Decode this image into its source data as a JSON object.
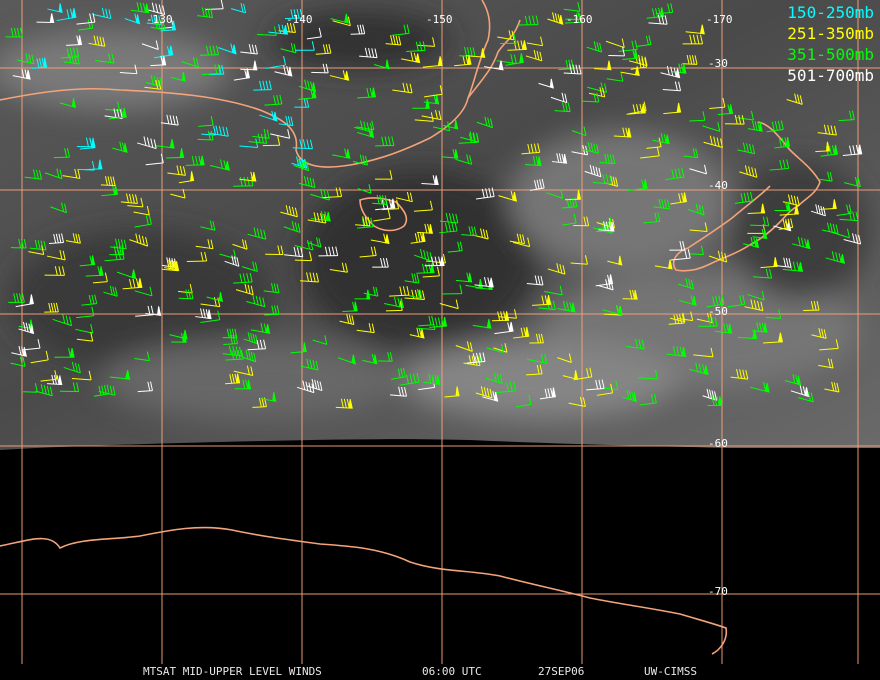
{
  "legend": [
    {
      "label": "150-250mb",
      "color": "#00ffff"
    },
    {
      "label": "251-350mb",
      "color": "#ffff00"
    },
    {
      "label": "351-500mb",
      "color": "#00ff00"
    },
    {
      "label": "501-700mb",
      "color": "#ffffff"
    }
  ],
  "longitude_labels": [
    "-130",
    "-140",
    "-150",
    "-160",
    "-170"
  ],
  "latitude_labels": [
    "-30",
    "-40",
    "-50",
    "-60",
    "-70"
  ],
  "footer": {
    "product": "MTSAT MID-UPPER LEVEL WINDS",
    "time": "06:00 UTC",
    "date": "27SEP06",
    "source": "UW-CIMSS"
  },
  "colors": {
    "grid": "#f4a37a",
    "coastline": "#f4a37a",
    "space": "#000000"
  }
}
